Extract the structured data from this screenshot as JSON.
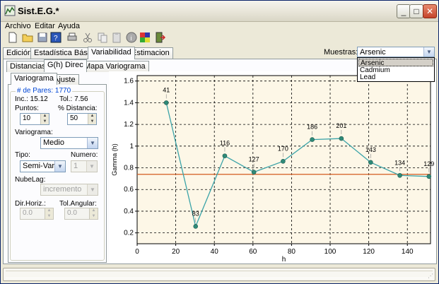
{
  "window": {
    "title": "Sist.E.G.*",
    "controls": {
      "minimize": "_",
      "maximize": "□",
      "close": "✕"
    }
  },
  "menu": [
    "Archivo",
    "Editar",
    "Ayuda"
  ],
  "toolbar_icons": [
    "new-file-icon",
    "open-folder-icon",
    "save-icon",
    "help-icon",
    "print-icon",
    "cut-icon",
    "copy-icon",
    "paste-icon",
    "info-icon",
    "grid-icon",
    "exit-icon"
  ],
  "main_tabs": [
    "Edición",
    "Estadística Básica",
    "Variabilidad",
    "Estimacion"
  ],
  "active_main_tab": "Variabilidad",
  "muestras": {
    "label": "Muestras:",
    "selected": "Arsenic",
    "options": [
      "Arsenic",
      "Cadmium",
      "Lead"
    ]
  },
  "sub_tabs": [
    "Distancias",
    "G(h) Direc",
    "Mapa Variograma"
  ],
  "active_sub_tab": "G(h) Direc",
  "panel_tabs": [
    "Variograma",
    "Ajuste"
  ],
  "active_panel_tab": "Variograma",
  "stats": {
    "pares": "# de Pares: 1770",
    "inc": "Inc.: 15.12",
    "tol": "Tol.: 7.56"
  },
  "form": {
    "puntos_label": "Puntos:",
    "puntos_value": "10",
    "distancia_label": "% Distancia:",
    "distancia_value": "50",
    "variograma_label": "Variograma:",
    "variograma_value": "Medio",
    "tipo_label": "Tipo:",
    "tipo_value": "Semi-Variog",
    "numero_label": "Numero:",
    "numero_value": "1",
    "nubelag_label": "NubeLag:",
    "nubelag_value": "incremento",
    "dirhoriz_label": "Dir.Horiz.:",
    "dirhoriz_value": "0.0",
    "tolangular_label": "Tol.Angular:",
    "tolangular_value": "0.0"
  },
  "colors": {
    "series_line": "#3aa3a8",
    "marker_fill": "#2f8a78",
    "reference_line": "#d25a1e",
    "plot_background": "#fdf7e7"
  },
  "chart_data": {
    "type": "line",
    "title": "",
    "xlabel": "h",
    "ylabel": "Gamma (h)",
    "xlim": [
      0,
      152
    ],
    "ylim": [
      0.1,
      1.65
    ],
    "xticks": [
      0,
      20,
      40,
      60,
      80,
      100,
      120,
      140
    ],
    "yticks": [
      0.2,
      0.4,
      0.6,
      0.8,
      1,
      1.2,
      1.4,
      1.6
    ],
    "grid": true,
    "series": [
      {
        "x": [
          15.1,
          30.3,
          45.4,
          60.5,
          75.6,
          90.7,
          105.8,
          121.0,
          136.1,
          151.2
        ],
        "y": [
          1.4,
          0.26,
          0.91,
          0.76,
          0.86,
          1.06,
          1.07,
          0.85,
          0.73,
          0.72
        ],
        "labels": [
          "41",
          "83",
          "116",
          "127",
          "170",
          "186",
          "201",
          "143",
          "134",
          "129"
        ]
      }
    ],
    "reference_line": {
      "y": 0.74
    }
  }
}
